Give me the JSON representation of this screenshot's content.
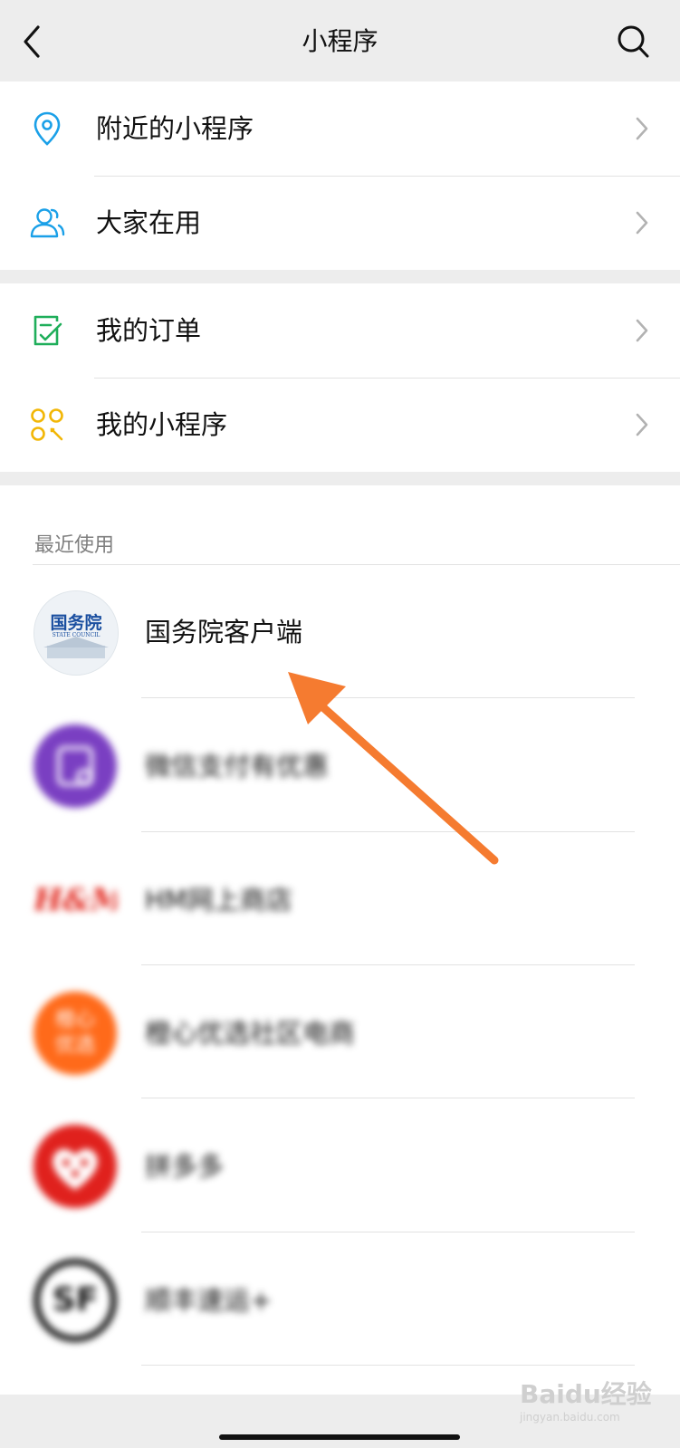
{
  "header": {
    "title": "小程序"
  },
  "menu_group_1": [
    {
      "label": "附近的小程序",
      "icon": "location-pin-icon"
    },
    {
      "label": "大家在用",
      "icon": "users-icon"
    }
  ],
  "menu_group_2": [
    {
      "label": "我的订单",
      "icon": "order-list-icon"
    },
    {
      "label": "我的小程序",
      "icon": "my-miniprograms-icon"
    }
  ],
  "recent": {
    "title": "最近使用",
    "items": [
      {
        "name": "国务院客户端",
        "logo_text": "国务院",
        "logo_sub": "STATE COUNCIL"
      },
      {
        "name": "微信支付有优惠",
        "logo_color": "#7a3fc2"
      },
      {
        "name": "HM网上商店",
        "logo_text": "H&M",
        "logo_color": "#e1251b"
      },
      {
        "name": "橙心优选社区电商",
        "logo_text": "橙心优选",
        "logo_color": "#ff6a1a"
      },
      {
        "name": "拼多多",
        "logo_color": "#e0211d"
      },
      {
        "name": "顺丰速运+",
        "logo_text": "SF",
        "logo_color": "#111111"
      }
    ]
  },
  "watermark": {
    "text": "Baidu经验",
    "sub": "jingyan.baidu.com"
  },
  "colors": {
    "accent_blue": "#1aa0e8",
    "accent_green": "#1fae5a",
    "accent_yellow": "#f2b707",
    "arrow_orange": "#f57b30"
  }
}
